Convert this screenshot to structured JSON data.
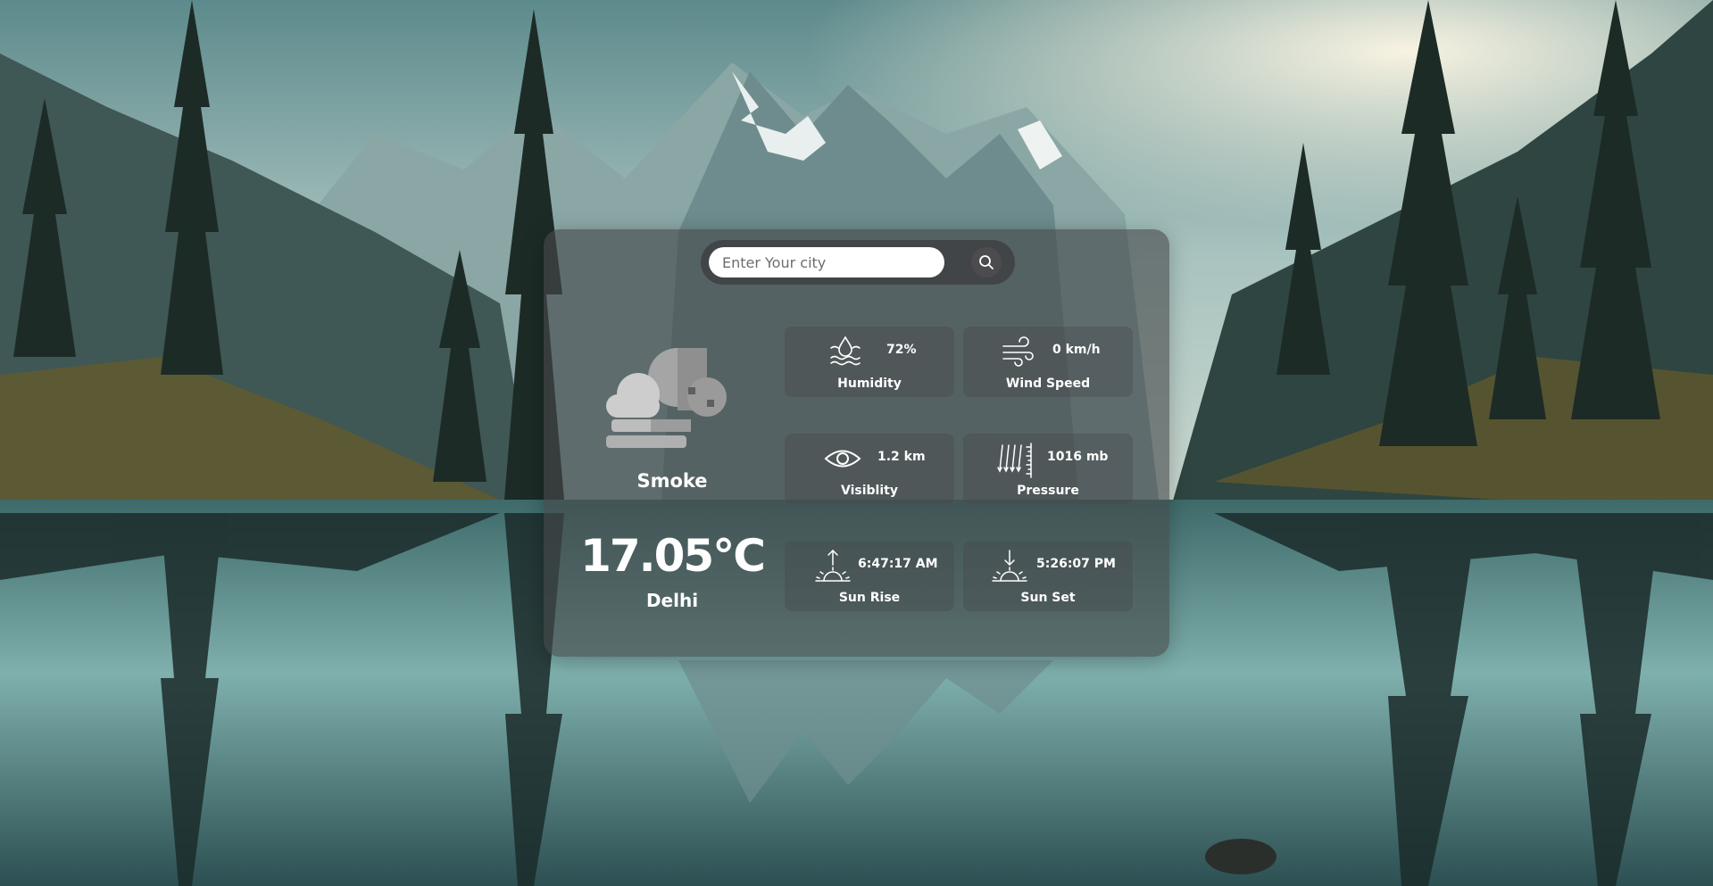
{
  "search": {
    "placeholder": "Enter Your city",
    "value": ""
  },
  "weather": {
    "condition": "Smoke",
    "temperature": "17.05°C",
    "city": "Delhi",
    "icon": "smoke-cloud-icon"
  },
  "details": {
    "humidity": {
      "value": "72%",
      "label": "Humidity",
      "icon": "humidity-icon"
    },
    "wind_speed": {
      "value": "0 km/h",
      "label": "Wind Speed",
      "icon": "wind-icon"
    },
    "visibility": {
      "value": "1.2 km",
      "label": "Visiblity",
      "icon": "eye-icon"
    },
    "pressure": {
      "value": "1016 mb",
      "label": "Pressure",
      "icon": "pressure-icon"
    },
    "sunrise": {
      "value": "6:47:17 AM",
      "label": "Sun Rise",
      "icon": "sunrise-icon"
    },
    "sunset": {
      "value": "5:26:07 PM",
      "label": "Sun Set",
      "icon": "sunset-icon"
    }
  }
}
